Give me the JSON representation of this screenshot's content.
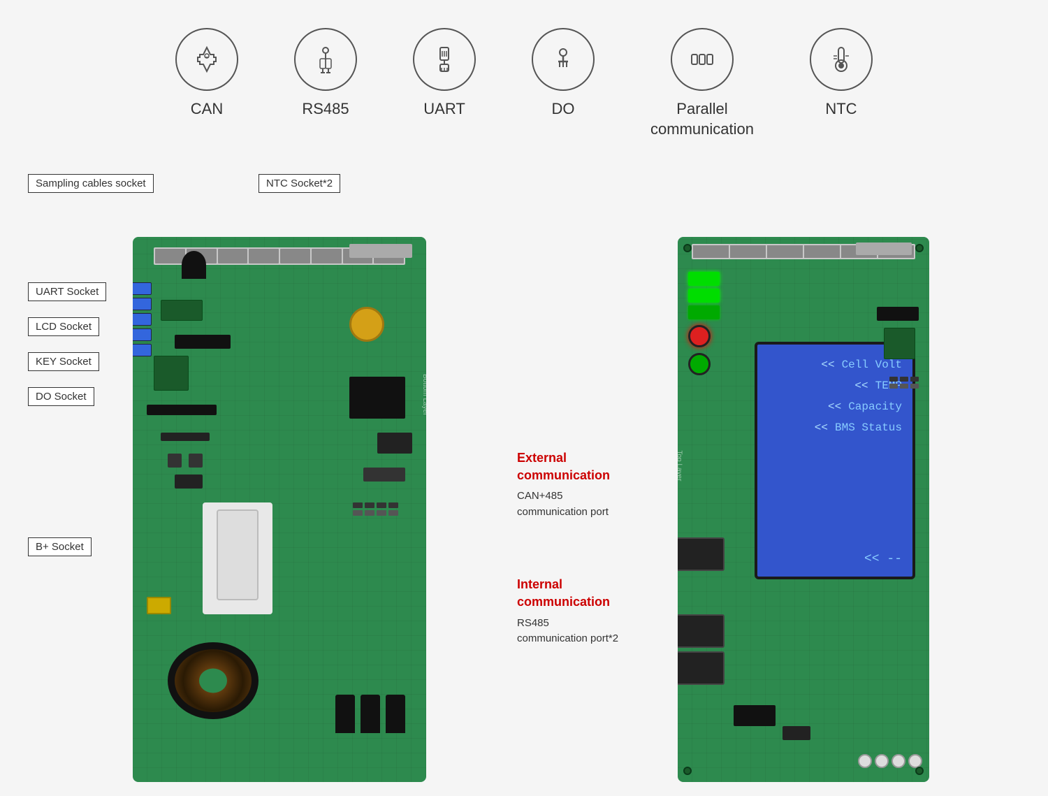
{
  "background": "#f5f5f5",
  "icons": [
    {
      "id": "can",
      "label": "CAN",
      "symbol": "rocket"
    },
    {
      "id": "rs485",
      "label": "RS485",
      "symbol": "cable"
    },
    {
      "id": "uart",
      "label": "UART",
      "symbol": "usb-serial"
    },
    {
      "id": "do",
      "label": "DO",
      "symbol": "usb"
    },
    {
      "id": "parallel",
      "label": "Parallel\ncommunication",
      "symbol": "parallel"
    },
    {
      "id": "ntc",
      "label": "NTC",
      "symbol": "thermometer"
    }
  ],
  "left_pcb": {
    "labels": [
      {
        "id": "sampling",
        "text": "Sampling cables socket"
      },
      {
        "id": "ntc-socket",
        "text": "NTC Socket*2"
      },
      {
        "id": "uart-socket",
        "text": "UART Socket"
      },
      {
        "id": "lcd-socket",
        "text": "LCD Socket"
      },
      {
        "id": "key-socket",
        "text": "KEY Socket"
      },
      {
        "id": "do-socket",
        "text": "DO Socket"
      },
      {
        "id": "b-plus-socket",
        "text": "B+ Socket"
      }
    ],
    "pcb_text": "Bottom Layer"
  },
  "right_comm": [
    {
      "id": "external",
      "title": "External\ncommunication",
      "desc": "CAN+485\ncommunication port"
    },
    {
      "id": "internal",
      "title": "Internal\ncommunication",
      "desc": "RS485\ncommunication port*2"
    }
  ],
  "right_pcb": {
    "pcb_text": "Top Layer",
    "lcd": {
      "rows": [
        {
          "arrow": "<<",
          "text": "Cell Volt"
        },
        {
          "arrow": "<<",
          "text": "TEMP"
        },
        {
          "arrow": "<<",
          "text": "Capacity"
        },
        {
          "arrow": "<<",
          "text": "BMS Status"
        }
      ],
      "bottom": "<< --"
    }
  }
}
